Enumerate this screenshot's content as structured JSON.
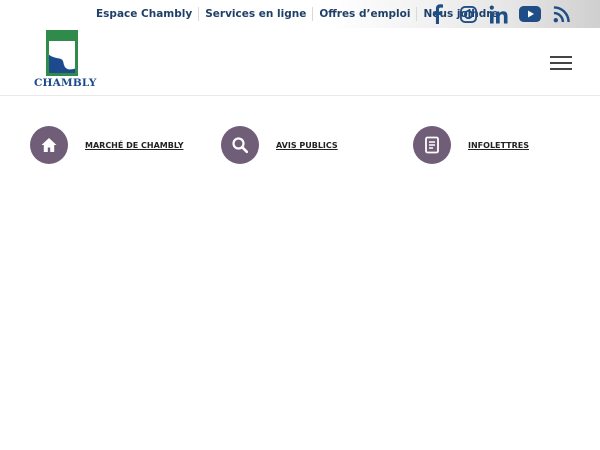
{
  "topbar": {
    "links": [
      {
        "label": "Espace Chambly"
      },
      {
        "label": "Services en ligne"
      },
      {
        "label": "Offres d’emploi"
      },
      {
        "label": "Nous joindre"
      }
    ],
    "social_icons": [
      "facebook-icon",
      "instagram-icon",
      "linkedin-icon",
      "youtube-icon",
      "rss-icon"
    ]
  },
  "header": {
    "logo_text": "CHAMBLY",
    "menu_icon": "hamburger-menu-icon"
  },
  "quick_links": [
    {
      "label": "MARCHÉ DE CHAMBLY",
      "icon": "home-icon"
    },
    {
      "label": "AVIS PUBLICS",
      "icon": "search-icon"
    },
    {
      "label": "INFOLETTRES",
      "icon": "document-icon"
    }
  ],
  "colors": {
    "link_blue": "#1f3f68",
    "social_blue": "#1f4e86",
    "circle_purple": "#705d78",
    "logo_green": "#2e8b4a",
    "logo_blue": "#1c4a8c"
  }
}
